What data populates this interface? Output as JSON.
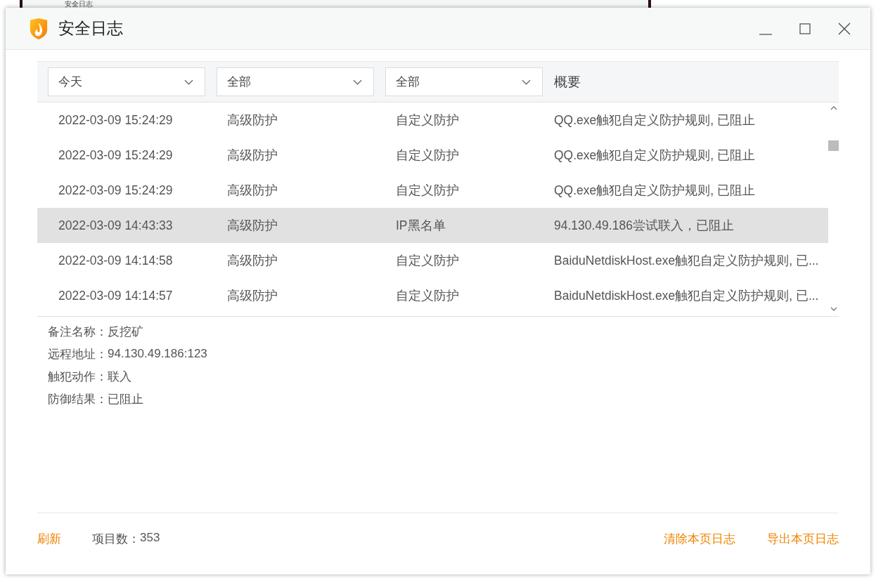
{
  "background_window": {
    "title": "安全日志"
  },
  "window": {
    "title": "安全日志"
  },
  "filters": [
    {
      "value": "今天"
    },
    {
      "value": "全部"
    },
    {
      "value": "全部"
    }
  ],
  "columns": {
    "column_4": "概要"
  },
  "rows": [
    {
      "time": "2022-03-09 15:24:29",
      "type": "高级防护",
      "category": "自定义防护",
      "summary": "QQ.exe触犯自定义防护规则, 已阻止",
      "selected": false
    },
    {
      "time": "2022-03-09 15:24:29",
      "type": "高级防护",
      "category": "自定义防护",
      "summary": "QQ.exe触犯自定义防护规则, 已阻止",
      "selected": false
    },
    {
      "time": "2022-03-09 15:24:29",
      "type": "高级防护",
      "category": "自定义防护",
      "summary": "QQ.exe触犯自定义防护规则, 已阻止",
      "selected": false
    },
    {
      "time": "2022-03-09 14:43:33",
      "type": "高级防护",
      "category": "IP黑名单",
      "summary": "94.130.49.186尝试联入，已阻止",
      "selected": true
    },
    {
      "time": "2022-03-09 14:14:58",
      "type": "高级防护",
      "category": "自定义防护",
      "summary": "BaiduNetdiskHost.exe触犯自定义防护规则, 已...",
      "selected": false
    },
    {
      "time": "2022-03-09 14:14:57",
      "type": "高级防护",
      "category": "自定义防护",
      "summary": "BaiduNetdiskHost.exe触犯自定义防护规则, 已...",
      "selected": false
    }
  ],
  "details": [
    {
      "label": "备注名称：",
      "value": "反挖矿"
    },
    {
      "label": "远程地址：",
      "value": "94.130.49.186:123"
    },
    {
      "label": "触犯动作：",
      "value": "联入"
    },
    {
      "label": "防御结果：",
      "value": "已阻止"
    }
  ],
  "footer": {
    "refresh": "刷新",
    "count_label": "项目数：",
    "count": "353",
    "actions": [
      "清除本页日志",
      "导出本页日志"
    ]
  }
}
